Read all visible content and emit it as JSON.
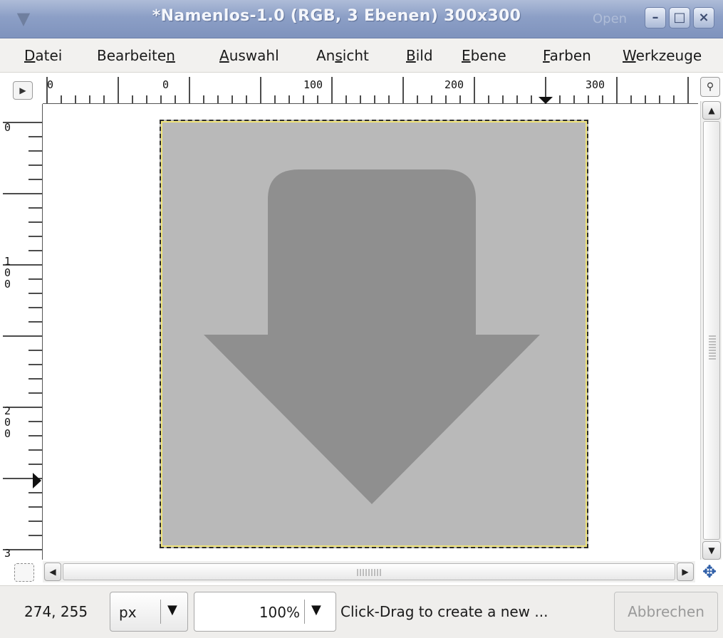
{
  "window": {
    "title": "*Namenlos-1.0 (RGB, 3 Ebenen) 300x300",
    "app_icon": "gimp-wilber-icon",
    "watermark": "Open"
  },
  "menu": {
    "items": [
      {
        "pre": "",
        "mn": "D",
        "post": "atei"
      },
      {
        "pre": "Bearbeite",
        "mn": "n",
        "post": ""
      },
      {
        "pre": "",
        "mn": "A",
        "post": "uswahl"
      },
      {
        "pre": "An",
        "mn": "s",
        "post": "icht"
      },
      {
        "pre": "",
        "mn": "B",
        "post": "ild"
      },
      {
        "pre": "",
        "mn": "E",
        "post": "bene"
      },
      {
        "pre": "",
        "mn": "F",
        "post": "arben"
      },
      {
        "pre": "",
        "mn": "W",
        "post": "erkzeuge"
      }
    ]
  },
  "rulers": {
    "horizontal_labels": [
      "0",
      "0",
      "100",
      "200",
      "300"
    ],
    "vertical_labels": [
      "0",
      "1\n0\n0",
      "2\n0\n0",
      "3"
    ]
  },
  "image": {
    "background_color": "#b9b9b9",
    "arrow_color": "#8f8f8f",
    "arrow_direction": "down"
  },
  "status": {
    "pointer_coords": "274, 255",
    "unit": "px",
    "zoom": "100%",
    "message": "Click-Drag to create a new ...",
    "cancel_label": "Abbrechen"
  }
}
